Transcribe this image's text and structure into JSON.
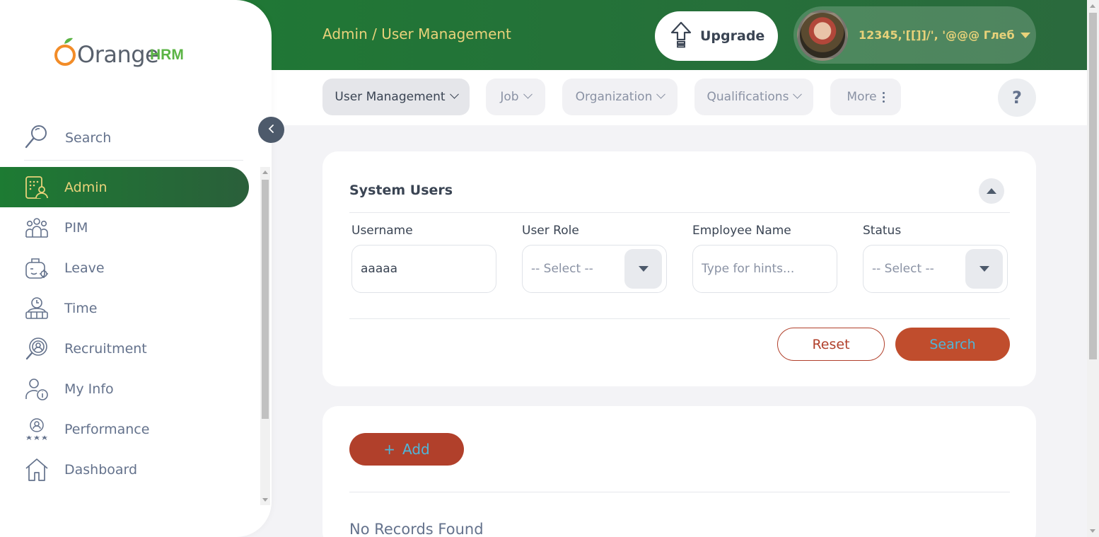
{
  "brand": {
    "logo_text_main": "Orange",
    "logo_text_accent": "HRM"
  },
  "header": {
    "breadcrumb": "Admin / User Management",
    "upgrade_label": "Upgrade",
    "user_name": "12345,'[[]]/', '@@@ Глеб"
  },
  "topnav": {
    "tabs": [
      {
        "label": "User Management",
        "icon": "chevron-down-icon",
        "active": true
      },
      {
        "label": "Job",
        "icon": "chevron-down-icon"
      },
      {
        "label": "Organization",
        "icon": "chevron-down-icon"
      },
      {
        "label": "Qualifications",
        "icon": "chevron-down-icon"
      },
      {
        "label": "More",
        "icon": "more-vertical-icon"
      }
    ],
    "help_label": "?"
  },
  "sidebar": {
    "search_label": "Search",
    "items": [
      {
        "label": "Admin",
        "icon": "admin-icon",
        "active": true
      },
      {
        "label": "PIM",
        "icon": "pim-icon"
      },
      {
        "label": "Leave",
        "icon": "leave-icon"
      },
      {
        "label": "Time",
        "icon": "time-icon"
      },
      {
        "label": "Recruitment",
        "icon": "recruitment-icon"
      },
      {
        "label": "My Info",
        "icon": "my-info-icon"
      },
      {
        "label": "Performance",
        "icon": "performance-icon"
      },
      {
        "label": "Dashboard",
        "icon": "dashboard-icon"
      }
    ]
  },
  "filter": {
    "title": "System Users",
    "fields": {
      "username": {
        "label": "Username",
        "value": "aaaaa"
      },
      "user_role": {
        "label": "User Role",
        "value": "-- Select --"
      },
      "employee_name": {
        "label": "Employee Name",
        "placeholder": "Type for hints..."
      },
      "status": {
        "label": "Status",
        "value": "-- Select --"
      }
    },
    "reset_label": "Reset",
    "search_label": "Search"
  },
  "records": {
    "add_label": "Add",
    "add_icon_glyph": "+",
    "empty_text": "No Records Found"
  },
  "colors": {
    "header_green": "#1d7b33",
    "accent_yellow": "#e8d27a",
    "primary_orange": "#c04d2d",
    "button_text_blue": "#4fb6d9"
  }
}
